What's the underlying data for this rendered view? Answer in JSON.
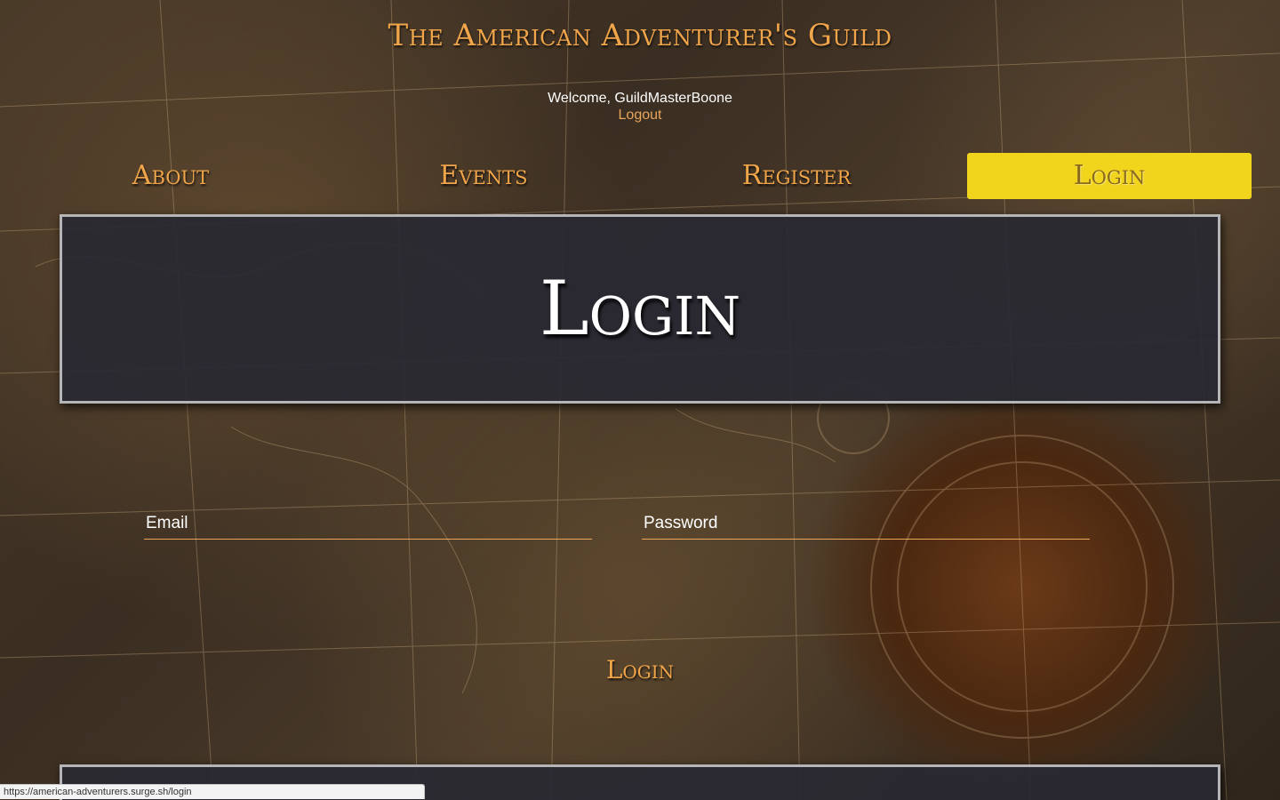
{
  "header": {
    "site_title": "The American Adventurer's Guild",
    "welcome_text": "Welcome, GuildMasterBoone",
    "logout_label": "Logout"
  },
  "nav": {
    "items": [
      {
        "label": "About",
        "active": false
      },
      {
        "label": "Events",
        "active": false
      },
      {
        "label": "Register",
        "active": false
      },
      {
        "label": "Login",
        "active": true
      }
    ]
  },
  "main": {
    "hero_title": "Login",
    "form": {
      "email_placeholder": "Email",
      "email_value": "",
      "password_placeholder": "Password",
      "password_value": "",
      "submit_label": "Login"
    }
  },
  "status_bar": {
    "url": "https://american-adventurers.surge.sh/login"
  },
  "colors": {
    "accent": "#f0a54a",
    "active_nav_bg": "#f1d41c",
    "panel_bg": "#282832",
    "panel_border": "#b5b5b8"
  }
}
